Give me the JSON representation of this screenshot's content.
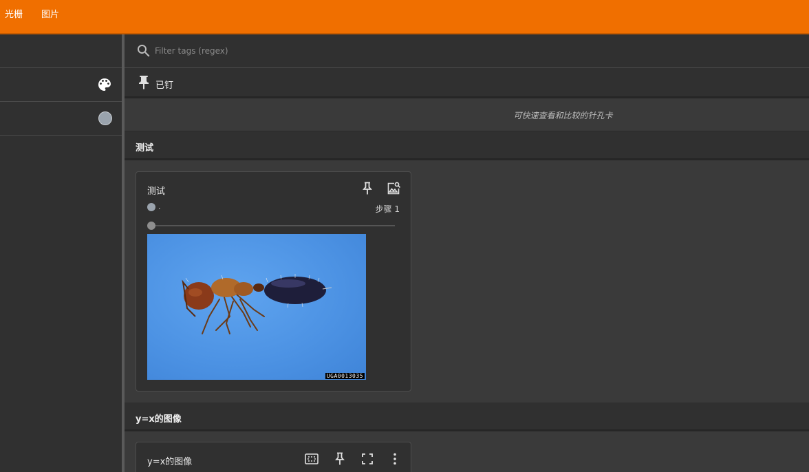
{
  "topbar": {
    "tabs": [
      {
        "label": "光栅"
      },
      {
        "label": "图片"
      }
    ],
    "accent": "#f06f00"
  },
  "sidebar": {
    "palette_icon": "palette-icon",
    "color_swatch": "#9aa3ad"
  },
  "filter": {
    "placeholder": "Filter tags (regex)",
    "value": ""
  },
  "pinned": {
    "header": "已钉",
    "empty_message": "可快速查看和比较的针孔卡"
  },
  "sections": [
    {
      "header": "测试",
      "card": {
        "title": "测试",
        "run_label": ".",
        "step_label": "步骤 1",
        "image_watermark": "UGA0013035",
        "slider_value": 0
      }
    },
    {
      "header": "y=x的图像",
      "card": {
        "title": "y=x的图像"
      }
    }
  ]
}
